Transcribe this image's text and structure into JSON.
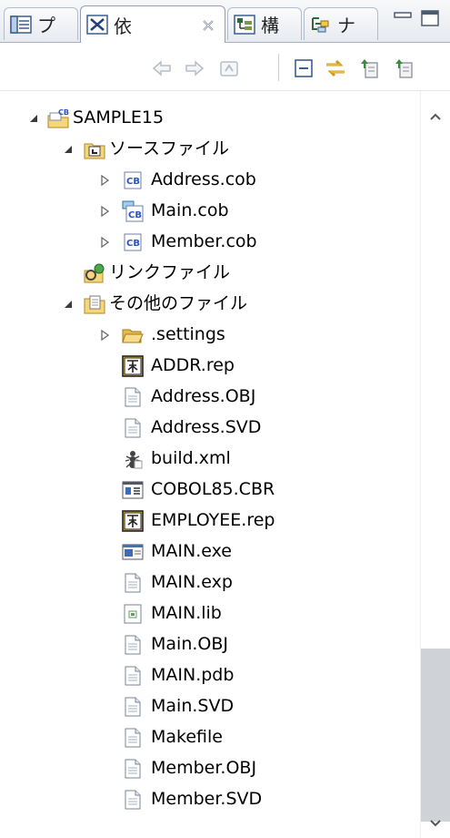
{
  "tabs": [
    {
      "label": "プ",
      "icon": "package-explorer-icon",
      "active": false
    },
    {
      "label": "依",
      "icon": "dependency-icon",
      "active": true
    },
    {
      "label": "構",
      "icon": "structure-icon",
      "active": false
    },
    {
      "label": "ナ",
      "icon": "navigator-icon",
      "active": false
    }
  ],
  "window_controls": [
    "minimize-icon",
    "maximize-icon"
  ],
  "toolbar": [
    "back-icon",
    "forward-icon",
    "up-icon",
    "collapse-all-icon",
    "link-with-editor-icon",
    "view-menu-icon",
    "view-menu-alt-icon"
  ],
  "tree": {
    "items": [
      {
        "label": "SAMPLE15",
        "icon": "cobol-project-icon",
        "expanded": true
      },
      {
        "label": "ソースファイル",
        "icon": "source-folder-icon",
        "expanded": true
      },
      {
        "label": "Address.cob",
        "icon": "cobol-source-icon",
        "expanded": false
      },
      {
        "label": "Main.cob",
        "icon": "cobol-main-source-icon",
        "expanded": false
      },
      {
        "label": "Member.cob",
        "icon": "cobol-source-icon",
        "expanded": false
      },
      {
        "label": "リンクファイル",
        "icon": "link-files-icon"
      },
      {
        "label": "その他のファイル",
        "icon": "other-files-folder-icon",
        "expanded": true
      },
      {
        "label": ".settings",
        "icon": "folder-icon",
        "expanded": false
      },
      {
        "label": "ADDR.rep",
        "icon": "report-file-icon"
      },
      {
        "label": "Address.OBJ",
        "icon": "file-icon"
      },
      {
        "label": "Address.SVD",
        "icon": "file-icon"
      },
      {
        "label": "build.xml",
        "icon": "ant-build-icon"
      },
      {
        "label": "COBOL85.CBR",
        "icon": "config-file-icon"
      },
      {
        "label": "EMPLOYEE.rep",
        "icon": "report-file-icon"
      },
      {
        "label": "MAIN.exe",
        "icon": "executable-icon"
      },
      {
        "label": "MAIN.exp",
        "icon": "file-icon"
      },
      {
        "label": "MAIN.lib",
        "icon": "library-file-icon"
      },
      {
        "label": "Main.OBJ",
        "icon": "file-icon"
      },
      {
        "label": "MAIN.pdb",
        "icon": "file-icon"
      },
      {
        "label": "Main.SVD",
        "icon": "file-icon"
      },
      {
        "label": "Makefile",
        "icon": "file-icon"
      },
      {
        "label": "Member.OBJ",
        "icon": "file-icon"
      },
      {
        "label": "Member.SVD",
        "icon": "file-icon"
      }
    ]
  }
}
